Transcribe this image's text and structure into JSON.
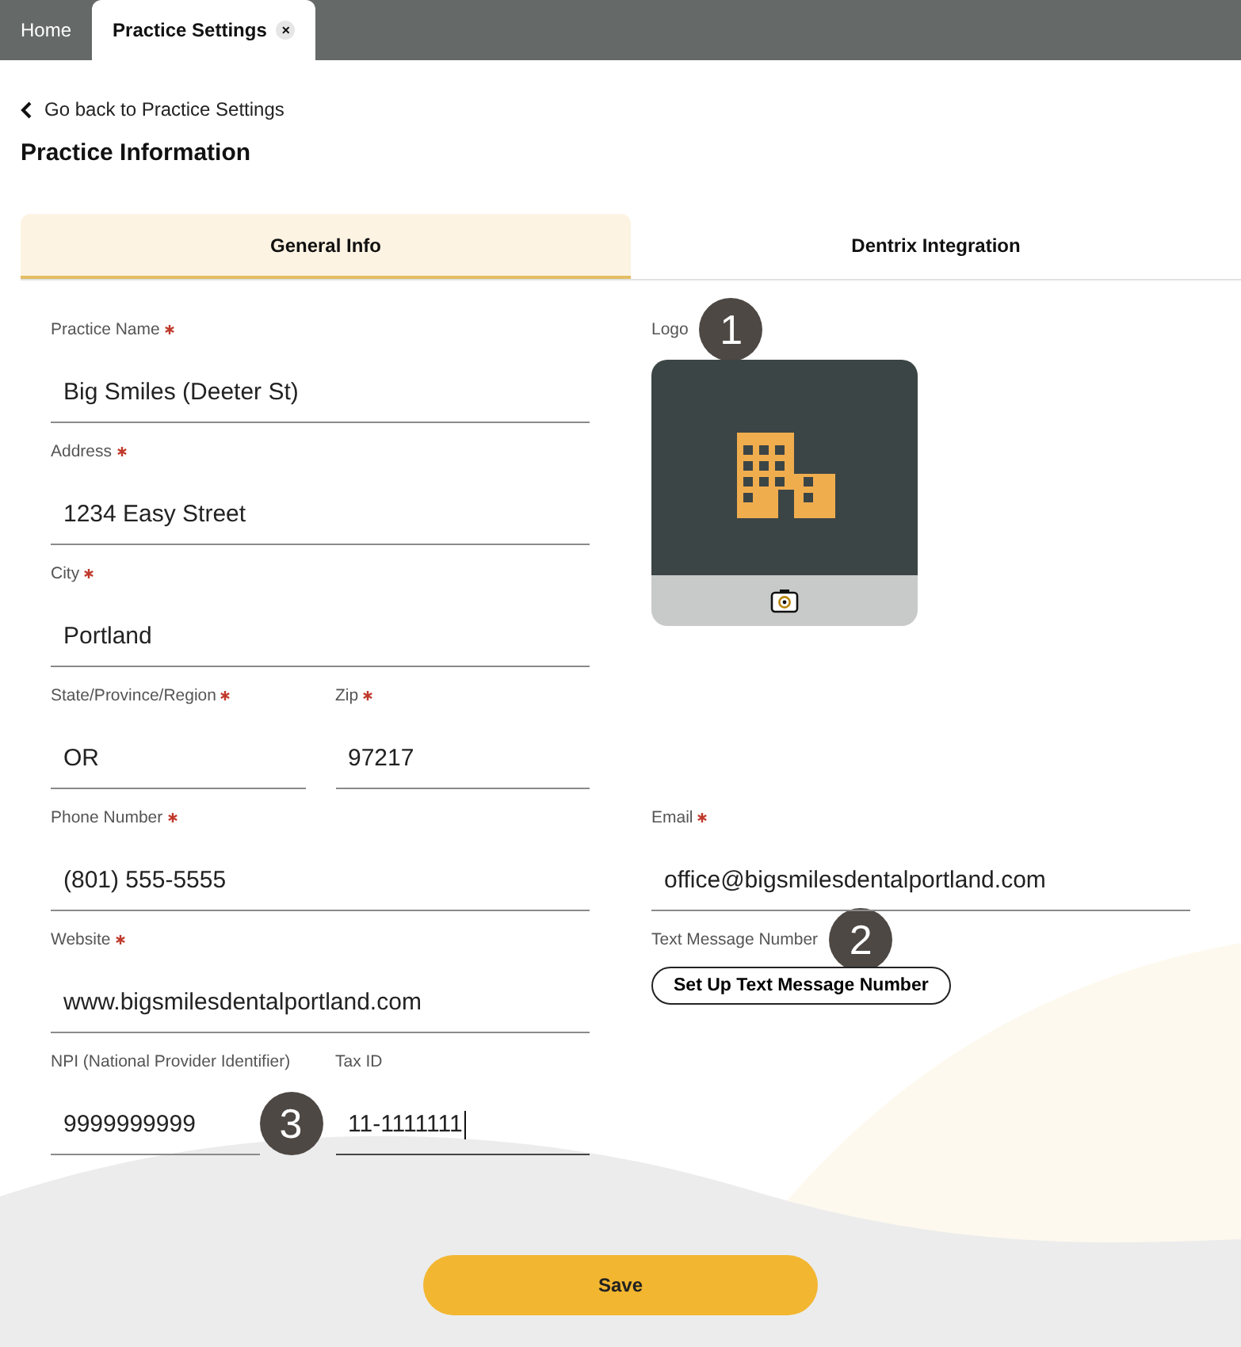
{
  "top_tabs": [
    {
      "label": "Home",
      "selected": false
    },
    {
      "label": "Practice Settings",
      "selected": true,
      "close": "×"
    }
  ],
  "back_link": "Go back to Practice Settings",
  "title": "Practice Information",
  "section_tabs": [
    {
      "label": "General Info",
      "selected": true
    },
    {
      "label": "Dentrix Integration",
      "selected": false
    }
  ],
  "left_rows": [
    [
      {
        "label": "Practice Name",
        "required": true,
        "value": "Big Smiles (Deeter St)",
        "focused": false
      }
    ],
    [
      {
        "label": "Address",
        "required": true,
        "value": "1234 Easy Street",
        "focused": false
      }
    ],
    [
      {
        "label": "City",
        "required": true,
        "value": "Portland",
        "focused": false
      }
    ],
    [
      {
        "label": "State/Province/Region",
        "required": true,
        "value": "OR",
        "focused": false
      },
      {
        "label": "Zip",
        "required": true,
        "value": "97217",
        "focused": false
      }
    ],
    [
      {
        "label": "Phone Number",
        "required": true,
        "value": "(801) 555-5555",
        "focused": false
      }
    ],
    [
      {
        "label": "Website",
        "required": true,
        "value": "www.bigsmilesdentalportland.com",
        "focused": false
      }
    ],
    [
      {
        "label": "NPI (National Provider Identifier)",
        "required": false,
        "value": "9999999999",
        "focused": false,
        "callout": "3"
      },
      {
        "label": "Tax ID",
        "required": false,
        "value": "11-1111111",
        "focused": true
      }
    ]
  ],
  "logo": {
    "label": "Logo",
    "callout": "1"
  },
  "email": {
    "label": "Email",
    "required": true,
    "value": "office@bigsmilesdentalportland.com",
    "focused": false
  },
  "text_message": {
    "label": "Text Message Number",
    "callout": "2",
    "button": "Set Up Text Message Number"
  },
  "save_button": "Save"
}
